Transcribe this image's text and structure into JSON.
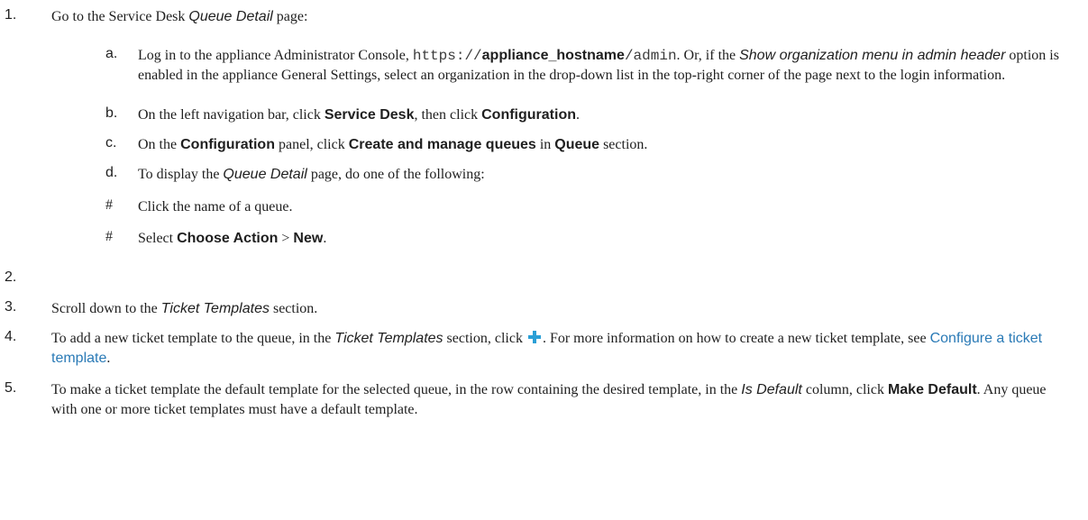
{
  "steps": {
    "s1": {
      "num": "1.",
      "pre": "Go to the Service Desk ",
      "page_em": "Queue Detail",
      "post": " page:"
    },
    "s2": {
      "num": "2."
    },
    "s3": {
      "num": "3.",
      "pre": "Scroll down to the ",
      "em": "Ticket Templates",
      "post": " section."
    },
    "s4": {
      "num": "4.",
      "pre": "To add a new ticket template to the queue, in the ",
      "em": "Ticket Templates",
      "mid": " section, click ",
      "post": ". For more information on how to create a new ticket template, see ",
      "link": "Configure a ticket template",
      "end": "."
    },
    "s5": {
      "num": "5.",
      "pre": "To make a ticket template the default template for the selected queue, in the row containing the desired template, in the ",
      "em": "Is Default",
      "mid": " column, click ",
      "ui": "Make Default",
      "post": ". Any queue with one or more ticket templates must have a default template."
    }
  },
  "substeps": {
    "a": {
      "letter": "a.",
      "pre": "Log in to the appliance Administrator Console, ",
      "mono1": "https://",
      "bold": "appliance_hostname",
      "mono2": "/admin",
      "mid": ". Or, if the ",
      "em": "Show organization menu in admin header",
      "post": " option is enabled in the appliance General Settings, select an organization in the drop-down list in the top-right corner of the page next to the login information."
    },
    "b": {
      "letter": "b.",
      "pre": "On the left navigation bar, click ",
      "ui1": "Service Desk",
      "mid": ", then click ",
      "ui2": "Configuration",
      "post": "."
    },
    "c": {
      "letter": "c.",
      "pre": "On the ",
      "ui1": "Configuration",
      "mid1": " panel, click ",
      "ui2": "Create and manage queues",
      "mid2": " in ",
      "ui3": "Queue",
      "post": " section."
    },
    "d": {
      "letter": "d.",
      "pre": "To display the ",
      "em": "Queue Detail",
      "post": " page, do one of the following:"
    },
    "opt1": {
      "mark": "#",
      "text": "Click the name of a queue."
    },
    "opt2": {
      "mark": "#",
      "pre": "Select ",
      "ui1": "Choose Action",
      "mid": " > ",
      "ui2": "New",
      "post": "."
    }
  },
  "icons": {
    "add": "plus-icon",
    "add_color": "#2a9fd6"
  }
}
